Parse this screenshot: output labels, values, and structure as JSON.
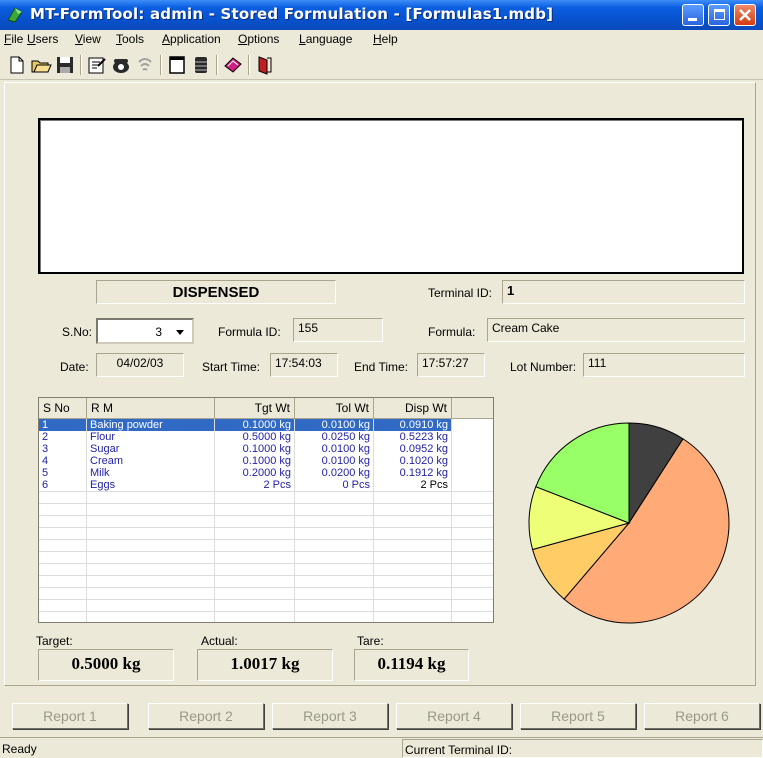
{
  "window": {
    "title": "MT-FormTool: admin - Stored Formulation - [Formulas1.mdb]"
  },
  "menu": [
    {
      "pre": "",
      "u": "F",
      "post": "ile"
    },
    {
      "pre": "",
      "u": "U",
      "post": "sers"
    },
    {
      "pre": "",
      "u": "V",
      "post": "iew"
    },
    {
      "pre": "",
      "u": "T",
      "post": "ools"
    },
    {
      "pre": "",
      "u": "A",
      "post": "pplication"
    },
    {
      "pre": "",
      "u": "O",
      "post": "ptions"
    },
    {
      "pre": "",
      "u": "L",
      "post": "anguage"
    },
    {
      "pre": "",
      "u": "H",
      "post": "elp"
    }
  ],
  "toolbar_icons": [
    "new-icon",
    "open-icon",
    "save-icon",
    "properties-icon",
    "phone-icon",
    "disabled-phone-icon",
    "document-icon",
    "database-icon",
    "book-icon",
    "exit-icon"
  ],
  "status_text": "DISPENSED",
  "terminal": {
    "label": "Terminal ID:",
    "value": "1"
  },
  "sno": {
    "label": "S.No:",
    "value": "3"
  },
  "formula_id": {
    "label": "Formula ID:",
    "value": "155"
  },
  "formula": {
    "label": "Formula:",
    "value": "Cream Cake"
  },
  "date": {
    "label": "Date:",
    "value": "04/02/03"
  },
  "start_time": {
    "label": "Start Time:",
    "value": "17:54:03"
  },
  "end_time": {
    "label": "End Time:",
    "value": "17:57:27"
  },
  "lot": {
    "label": "Lot Number:",
    "value": "111"
  },
  "grid": {
    "columns": [
      "S No",
      "R M",
      "Tgt Wt",
      "Tol Wt",
      "Disp Wt"
    ],
    "rows": [
      {
        "sno": "1",
        "rm": "Baking powder",
        "tgt": "0.1000 kg",
        "tol": "0.0100 kg",
        "disp": "0.0910 kg"
      },
      {
        "sno": "2",
        "rm": "Flour",
        "tgt": "0.5000 kg",
        "tol": "0.0250 kg",
        "disp": "0.5223 kg"
      },
      {
        "sno": "3",
        "rm": "Sugar",
        "tgt": "0.1000 kg",
        "tol": "0.0100 kg",
        "disp": "0.0952 kg"
      },
      {
        "sno": "4",
        "rm": "Cream",
        "tgt": "0.1000 kg",
        "tol": "0.0100 kg",
        "disp": "0.1020 kg"
      },
      {
        "sno": "5",
        "rm": "Milk",
        "tgt": "0.2000 kg",
        "tol": "0.0200 kg",
        "disp": "0.1912 kg"
      },
      {
        "sno": "6",
        "rm": "Eggs",
        "tgt": "2 Pcs",
        "tol": "0 Pcs",
        "disp": "2 Pcs"
      }
    ]
  },
  "totals": {
    "target_label": "Target:",
    "target": "0.5000 kg",
    "actual_label": "Actual:",
    "actual": "1.0017 kg",
    "tare_label": "Tare:",
    "tare": "0.1194 kg"
  },
  "reports": [
    "Report 1",
    "Report 2",
    "Report 3",
    "Report 4",
    "Report 5",
    "Report 6"
  ],
  "statusbar": {
    "left": "Ready",
    "right": "Current Terminal ID:"
  },
  "chart_data": {
    "type": "pie",
    "title": "",
    "slices": [
      {
        "value": 9.1,
        "color": "#404040"
      },
      {
        "value": 52.2,
        "color": "#ffaa77"
      },
      {
        "value": 9.5,
        "color": "#ffcc66"
      },
      {
        "value": 10.2,
        "color": "#eeff77"
      },
      {
        "value": 19.1,
        "color": "#99ff66"
      }
    ]
  }
}
